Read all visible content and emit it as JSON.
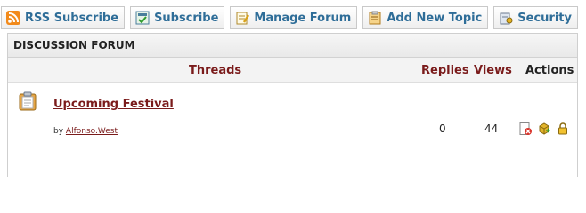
{
  "toolbar": {
    "rss_label": "RSS Subscribe",
    "subscribe_label": "Subscribe",
    "manage_label": "Manage Forum",
    "new_topic_label": "Add New Topic",
    "security_label": "Security"
  },
  "forum": {
    "title": "DISCUSSION FORUM",
    "columns": {
      "threads": "Threads",
      "replies": "Replies",
      "views": "Views",
      "actions": "Actions"
    },
    "threads": [
      {
        "title": "Upcoming Festival",
        "by_prefix": "by",
        "author": "Alfonso.West",
        "replies": "0",
        "views": "44"
      }
    ]
  },
  "colors": {
    "link_maroon": "#7a1b1b",
    "button_text_blue": "#2e6d98"
  },
  "icons": [
    "rss-icon",
    "subscribe-icon",
    "manage-forum-icon",
    "new-topic-icon",
    "security-icon",
    "thread-clipboard-icon",
    "delete-icon",
    "move-icon",
    "lock-icon"
  ]
}
